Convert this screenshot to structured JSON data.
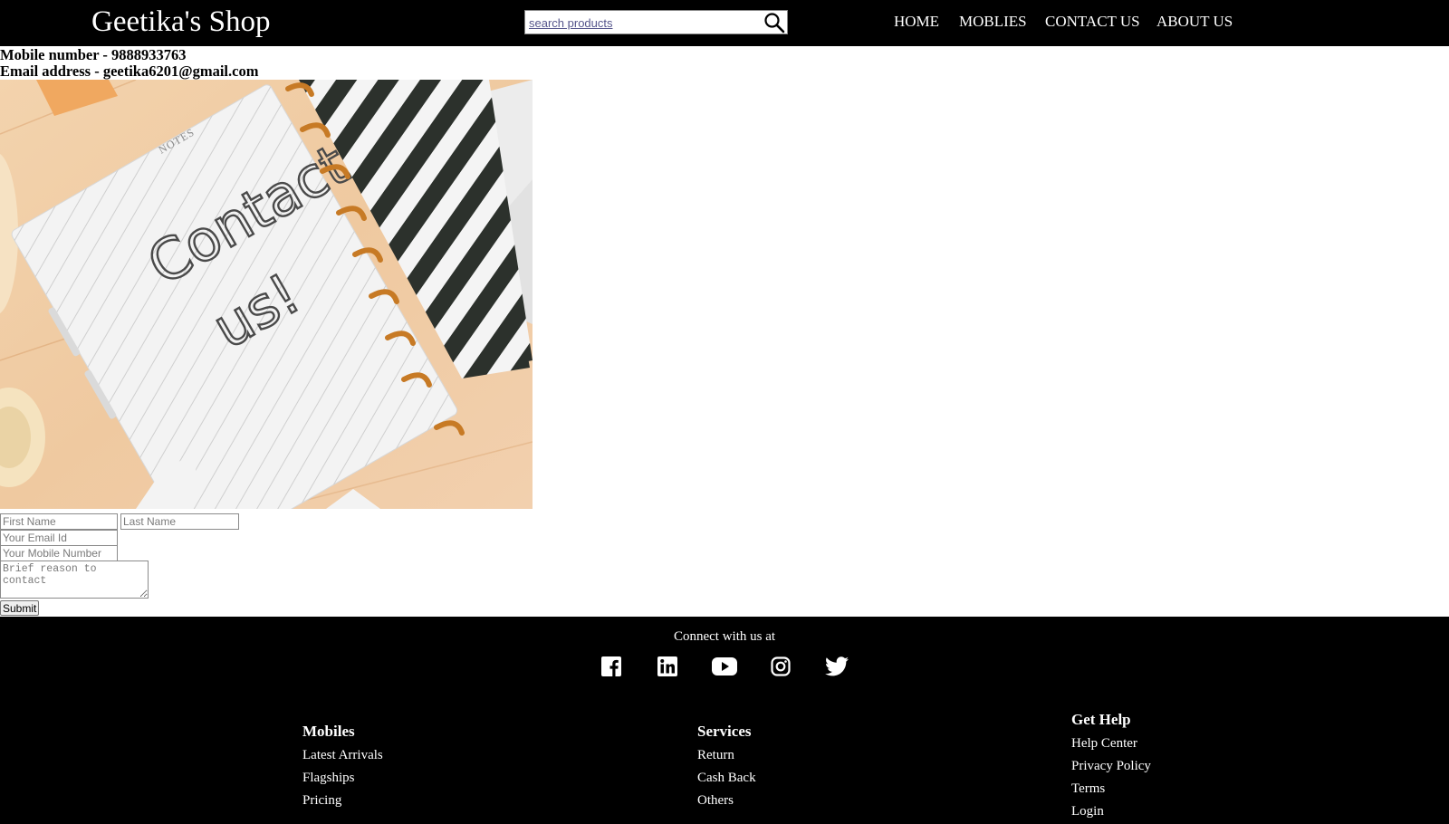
{
  "header": {
    "brand": "Geetika's Shop",
    "search_placeholder": "search products",
    "search_icon": "magnifier-icon",
    "nav": [
      "HOME",
      "MOBLIES",
      "CONTACT US",
      "ABOUT US"
    ]
  },
  "contact": {
    "mobile": "Mobile number - 9888933763",
    "email": "Email address - geetika6201@gmail.com"
  },
  "hero": {
    "handwriting_line1": "Contact",
    "handwriting_line2": "us!",
    "notes_label": "NOTES"
  },
  "form": {
    "first_name_placeholder": "First Name",
    "last_name_placeholder": "Last Name",
    "email_placeholder": "Your Email Id",
    "mobile_placeholder": "Your Mobile Number",
    "reason_placeholder": "Brief reason to contact",
    "submit_label": "Submit"
  },
  "footer": {
    "connect_text": "Connect with us at",
    "social_icons": [
      "facebook-icon",
      "linkedin-icon",
      "youtube-icon",
      "instagram-icon",
      "twitter-icon"
    ],
    "columns": [
      {
        "title": "Mobiles",
        "links": [
          "Latest Arrivals",
          "Flagships",
          "Pricing"
        ]
      },
      {
        "title": "Services",
        "links": [
          "Return",
          "Cash Back",
          "Others"
        ]
      },
      {
        "title": "Get Help",
        "links": [
          "Help Center",
          "Privacy Policy",
          "Terms",
          "Login"
        ]
      }
    ]
  },
  "colors": {
    "header_bg": "#000000",
    "footer_bg": "#000000",
    "text_on_dark": "#ffffff"
  }
}
